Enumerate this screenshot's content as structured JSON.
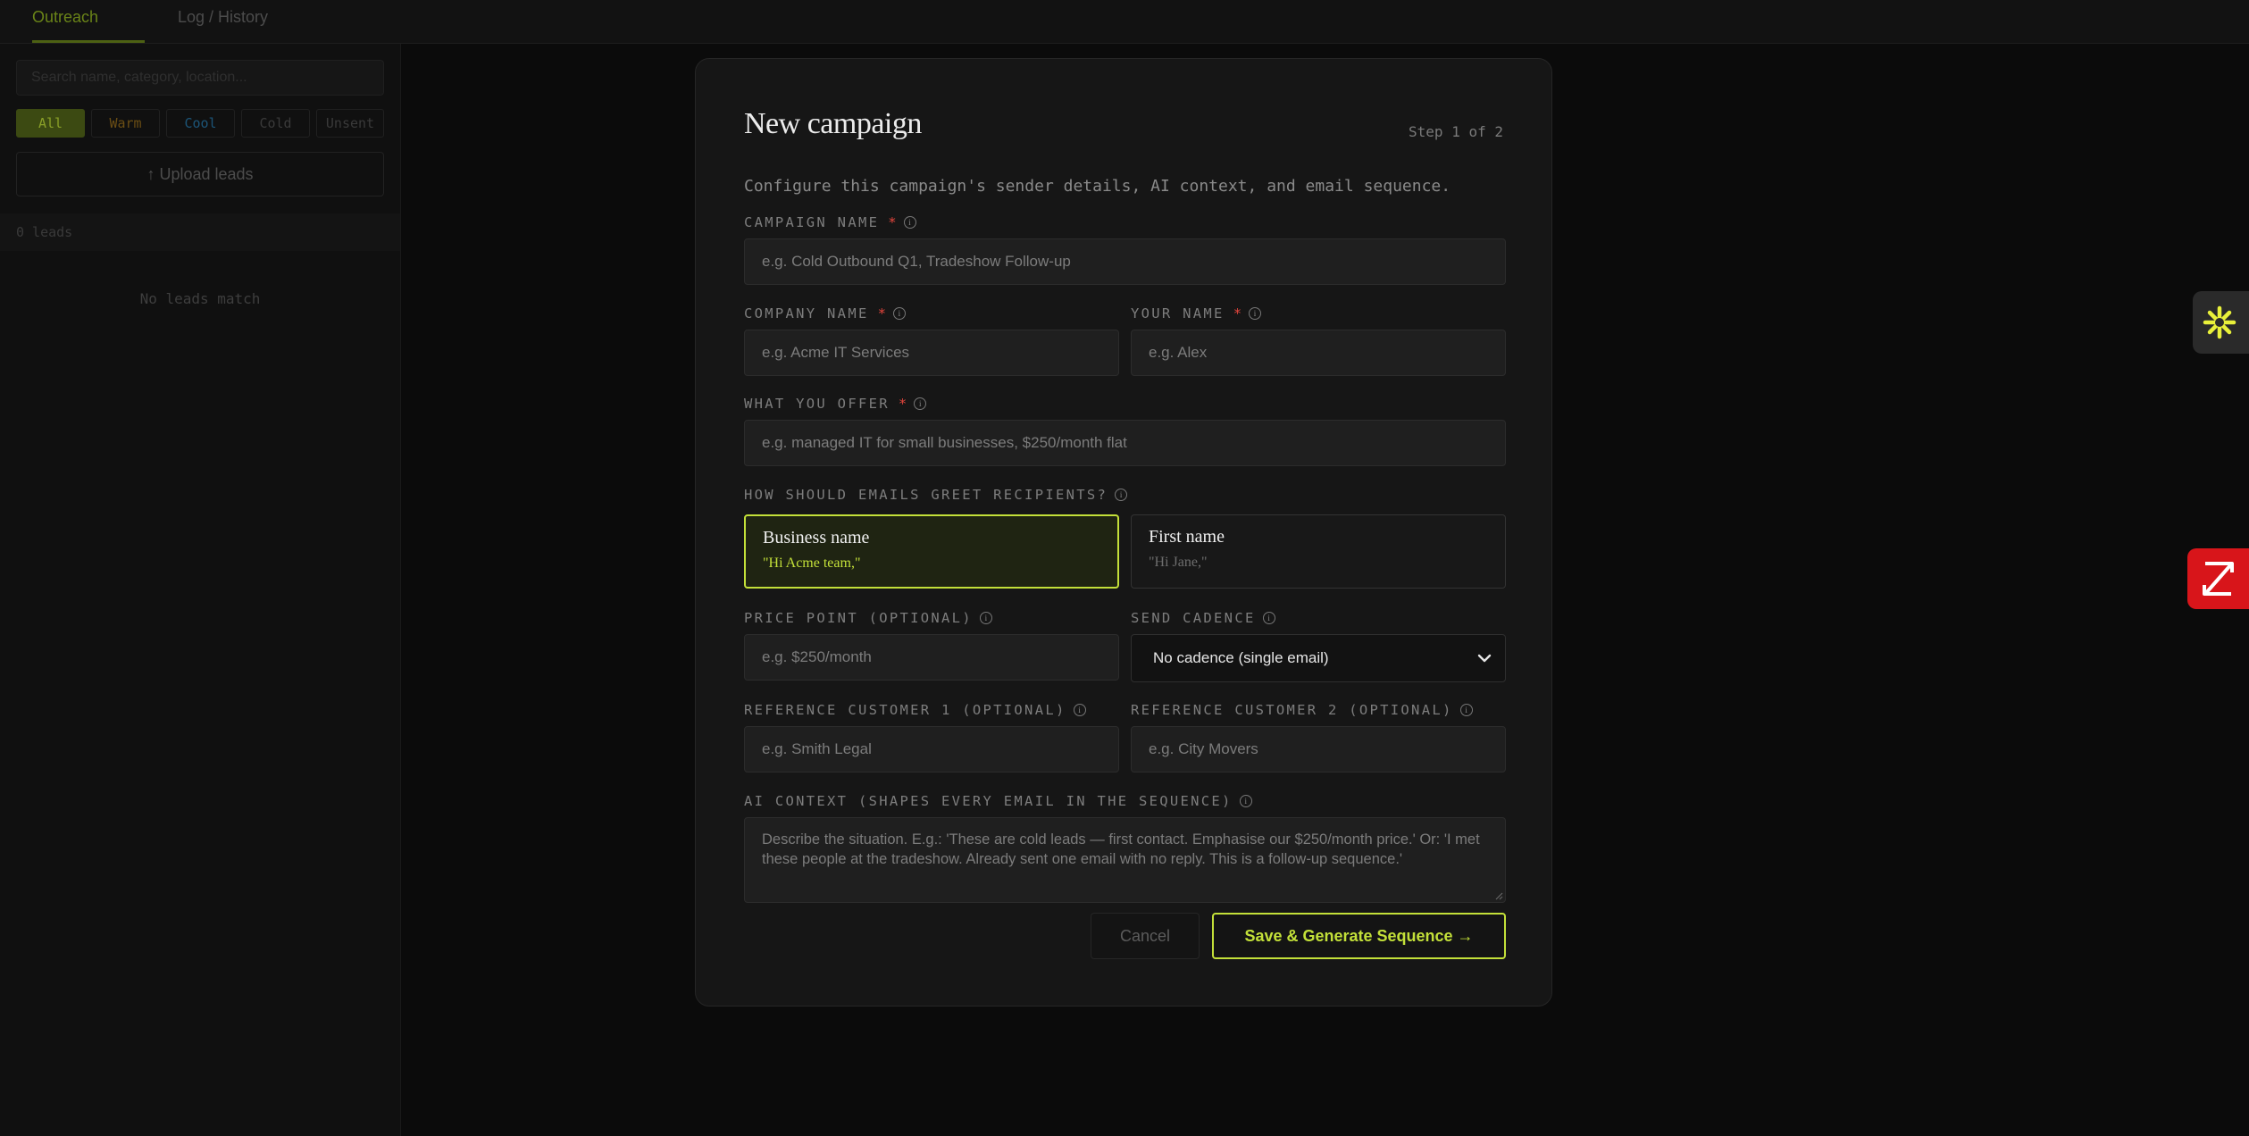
{
  "tabs": [
    {
      "label": "Outreach",
      "active": true
    },
    {
      "label": "Log / History",
      "active": false
    }
  ],
  "sidebar": {
    "search_placeholder": "Search name, category, location...",
    "filters": [
      "All",
      "Warm",
      "Cool",
      "Cold",
      "Unsent"
    ],
    "filter_colors": {
      "All": "#8aa028",
      "Warm": "#7a5a1a",
      "Cool": "#1f5e82"
    },
    "upload_label": "↑ Upload leads",
    "lead_count": "0 leads",
    "empty_text": "No leads match"
  },
  "modal": {
    "title": "New campaign",
    "step": "Step 1 of 2",
    "description": "Configure this campaign's sender details, AI context, and email sequence.",
    "fields": {
      "campaign_name": {
        "label": "CAMPAIGN NAME",
        "placeholder": "e.g. Cold Outbound Q1, Tradeshow Follow-up"
      },
      "company_name": {
        "label": "COMPANY NAME",
        "placeholder": "e.g. Acme IT Services"
      },
      "your_name": {
        "label": "YOUR NAME",
        "placeholder": "e.g. Alex"
      },
      "offer": {
        "label": "WHAT YOU OFFER",
        "placeholder": "e.g. managed IT for small businesses, $250/month flat"
      },
      "greeting_label": "HOW SHOULD EMAILS GREET RECIPIENTS?",
      "greeting_options": [
        {
          "title": "Business name",
          "example": "\"Hi Acme team,\"",
          "selected": true
        },
        {
          "title": "First name",
          "example": "\"Hi Jane,\"",
          "selected": false
        }
      ],
      "price_point": {
        "label": "PRICE POINT (OPTIONAL)",
        "placeholder": "e.g. $250/month"
      },
      "cadence": {
        "label": "SEND CADENCE",
        "value": "No cadence (single email)"
      },
      "ref1": {
        "label": "REFERENCE CUSTOMER 1 (OPTIONAL)",
        "placeholder": "e.g. Smith Legal"
      },
      "ref2": {
        "label": "REFERENCE CUSTOMER 2 (OPTIONAL)",
        "placeholder": "e.g. City Movers"
      },
      "ai_context": {
        "label": "AI CONTEXT (SHAPES EVERY EMAIL IN THE SEQUENCE)",
        "placeholder": "Describe the situation. E.g.: 'These are cold leads — first contact. Emphasise our $250/month price.' Or: 'I met these people at the tradeshow. Already sent one email with no reply. This is a follow-up sequence.'"
      }
    },
    "required_mark": "*",
    "info_glyph": "i",
    "cancel_label": "Cancel",
    "save_label": "Save & Generate Sequence →"
  },
  "colors": {
    "accent": "#c3e039",
    "required": "#e2453c",
    "widget_red": "#d8151a",
    "widget_yellow": "#e8f03a"
  }
}
